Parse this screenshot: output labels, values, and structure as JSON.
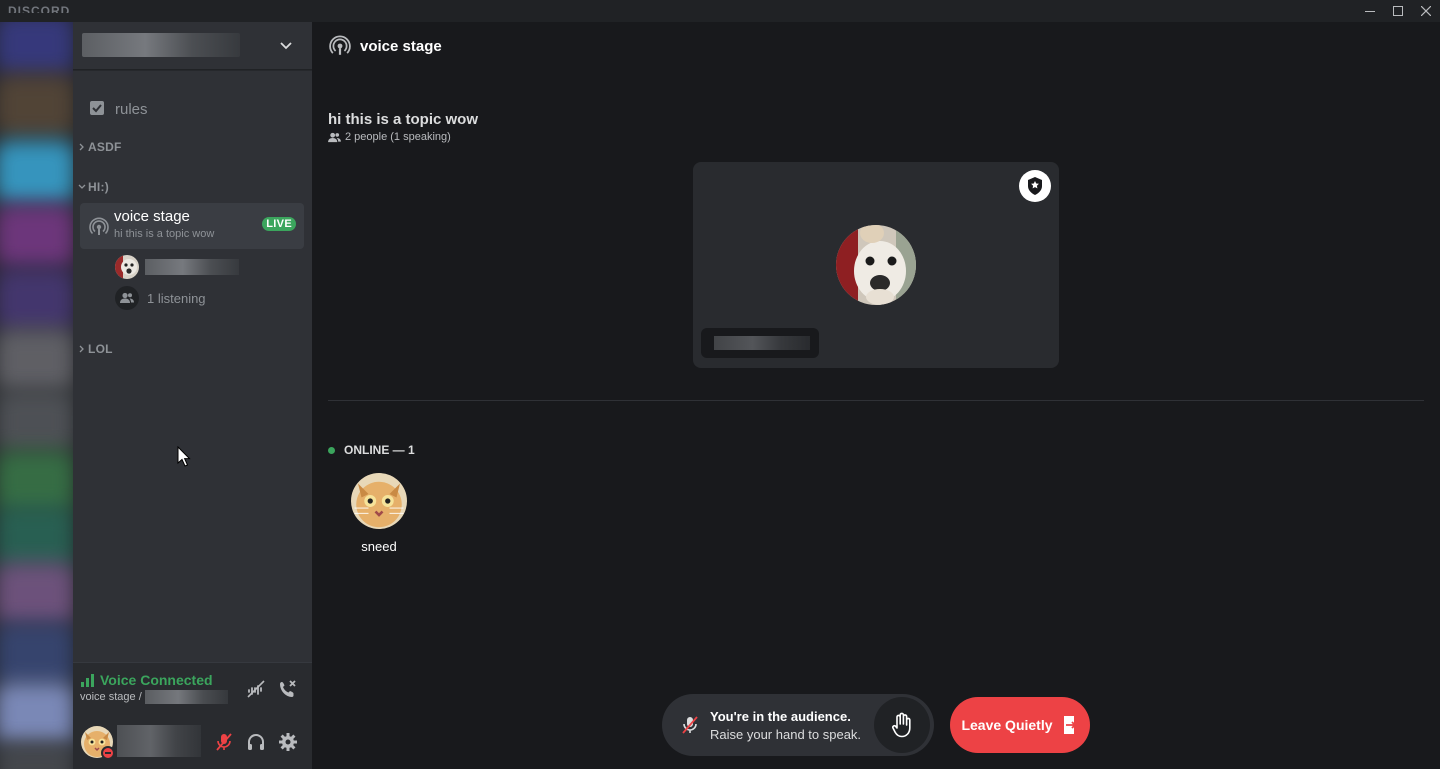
{
  "window": {
    "wordmark": "DISCORD",
    "controls": [
      "minimize-icon",
      "maximize-icon",
      "close-icon"
    ]
  },
  "sidebar": {
    "server_name": "",
    "channels": [
      {
        "name": "rules",
        "icon": "rules-checkbox-icon"
      }
    ],
    "categories": [
      {
        "name": "ASDF",
        "collapsed": true
      },
      {
        "name": "HI:)",
        "collapsed": false
      },
      {
        "name": "LOL",
        "collapsed": true
      }
    ],
    "stage_channel": {
      "name": "voice stage",
      "topic": "hi this is a topic wow",
      "badge": "LIVE",
      "listening": "1 listening"
    },
    "voice_connection": {
      "status": "Voice Connected",
      "channel": "voice stage /",
      "status_color": "#3ba55d"
    }
  },
  "main": {
    "header_title": "voice stage",
    "topic": "hi this is a topic wow",
    "people": "2 people (1 speaking)",
    "online_header": "ONLINE — 1",
    "audience": [
      {
        "name": "sneed"
      }
    ],
    "audience_message": {
      "line1": "You're in the audience.",
      "line2": "Raise your hand to speak."
    },
    "leave_button": "Leave Quietly"
  },
  "colors": {
    "accent_live": "#3ba55d",
    "danger": "#ed4245",
    "sidebar_bg": "#2f3136",
    "main_bg": "#18191c"
  }
}
